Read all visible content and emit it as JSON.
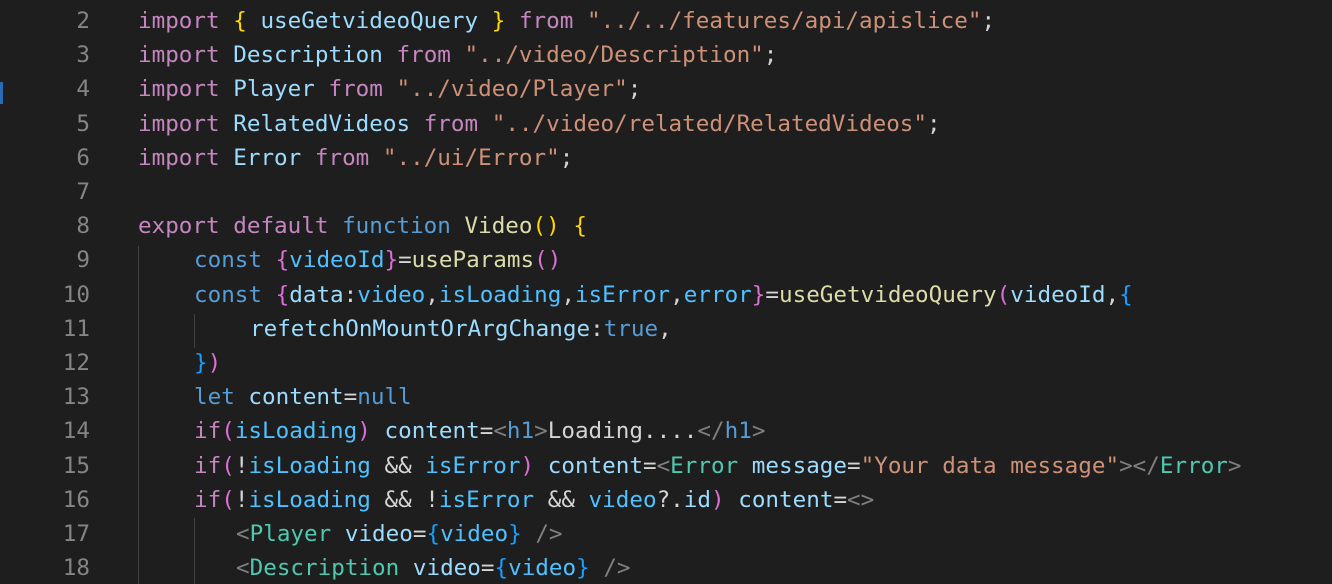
{
  "editor": {
    "lines": [
      {
        "number": "2",
        "indent": 0,
        "tokens": [
          {
            "t": "import",
            "c": "kw"
          },
          {
            "t": " ",
            "c": "p"
          },
          {
            "t": "{",
            "c": "b1"
          },
          {
            "t": " ",
            "c": "p"
          },
          {
            "t": "useGetvideoQuery",
            "c": "var"
          },
          {
            "t": " ",
            "c": "p"
          },
          {
            "t": "}",
            "c": "b1"
          },
          {
            "t": " ",
            "c": "p"
          },
          {
            "t": "from",
            "c": "kw"
          },
          {
            "t": " ",
            "c": "p"
          },
          {
            "t": "\"../../features/api/apislice\"",
            "c": "str"
          },
          {
            "t": ";",
            "c": "p"
          }
        ]
      },
      {
        "number": "3",
        "indent": 0,
        "tokens": [
          {
            "t": "import",
            "c": "kw"
          },
          {
            "t": " ",
            "c": "p"
          },
          {
            "t": "Description",
            "c": "var"
          },
          {
            "t": " ",
            "c": "p"
          },
          {
            "t": "from",
            "c": "kw"
          },
          {
            "t": " ",
            "c": "p"
          },
          {
            "t": "\"../video/Description\"",
            "c": "str"
          },
          {
            "t": ";",
            "c": "p"
          }
        ]
      },
      {
        "number": "4",
        "indent": 0,
        "tokens": [
          {
            "t": "import",
            "c": "kw"
          },
          {
            "t": " ",
            "c": "p"
          },
          {
            "t": "Player",
            "c": "var"
          },
          {
            "t": " ",
            "c": "p"
          },
          {
            "t": "from",
            "c": "kw"
          },
          {
            "t": " ",
            "c": "p"
          },
          {
            "t": "\"../video/Player\"",
            "c": "str"
          },
          {
            "t": ";",
            "c": "p"
          }
        ]
      },
      {
        "number": "5",
        "indent": 0,
        "tokens": [
          {
            "t": "import",
            "c": "kw"
          },
          {
            "t": " ",
            "c": "p"
          },
          {
            "t": "RelatedVideos",
            "c": "var"
          },
          {
            "t": " ",
            "c": "p"
          },
          {
            "t": "from",
            "c": "kw"
          },
          {
            "t": " ",
            "c": "p"
          },
          {
            "t": "\"../video/related/RelatedVideos\"",
            "c": "str"
          },
          {
            "t": ";",
            "c": "p"
          }
        ]
      },
      {
        "number": "6",
        "indent": 0,
        "tokens": [
          {
            "t": "import",
            "c": "kw"
          },
          {
            "t": " ",
            "c": "p"
          },
          {
            "t": "Error",
            "c": "var"
          },
          {
            "t": " ",
            "c": "p"
          },
          {
            "t": "from",
            "c": "kw"
          },
          {
            "t": " ",
            "c": "p"
          },
          {
            "t": "\"../ui/Error\"",
            "c": "str"
          },
          {
            "t": ";",
            "c": "p"
          }
        ]
      },
      {
        "number": "7",
        "indent": 0,
        "tokens": []
      },
      {
        "number": "8",
        "indent": 0,
        "tokens": [
          {
            "t": "export",
            "c": "kw"
          },
          {
            "t": " ",
            "c": "p"
          },
          {
            "t": "default",
            "c": "kw"
          },
          {
            "t": " ",
            "c": "p"
          },
          {
            "t": "function",
            "c": "st"
          },
          {
            "t": " ",
            "c": "p"
          },
          {
            "t": "Video",
            "c": "fn"
          },
          {
            "t": "()",
            "c": "b1"
          },
          {
            "t": " ",
            "c": "p"
          },
          {
            "t": "{",
            "c": "b1"
          }
        ]
      },
      {
        "number": "9",
        "indent": 1,
        "tokens": [
          {
            "t": "const",
            "c": "st"
          },
          {
            "t": " ",
            "c": "p"
          },
          {
            "t": "{",
            "c": "b2"
          },
          {
            "t": "videoId",
            "c": "const"
          },
          {
            "t": "}",
            "c": "b2"
          },
          {
            "t": "=",
            "c": "p"
          },
          {
            "t": "useParams",
            "c": "fn"
          },
          {
            "t": "()",
            "c": "b2"
          }
        ]
      },
      {
        "number": "10",
        "indent": 1,
        "tokens": [
          {
            "t": "const",
            "c": "st"
          },
          {
            "t": " ",
            "c": "p"
          },
          {
            "t": "{",
            "c": "b2"
          },
          {
            "t": "data",
            "c": "var"
          },
          {
            "t": ":",
            "c": "p"
          },
          {
            "t": "video",
            "c": "const"
          },
          {
            "t": ",",
            "c": "p"
          },
          {
            "t": "isLoading",
            "c": "const"
          },
          {
            "t": ",",
            "c": "p"
          },
          {
            "t": "isError",
            "c": "const"
          },
          {
            "t": ",",
            "c": "p"
          },
          {
            "t": "error",
            "c": "const"
          },
          {
            "t": "}",
            "c": "b2"
          },
          {
            "t": "=",
            "c": "p"
          },
          {
            "t": "useGetvideoQuery",
            "c": "fn"
          },
          {
            "t": "(",
            "c": "b2"
          },
          {
            "t": "videoId",
            "c": "var"
          },
          {
            "t": ",",
            "c": "p"
          },
          {
            "t": "{",
            "c": "b3"
          }
        ]
      },
      {
        "number": "11",
        "indent": 2,
        "tokens": [
          {
            "t": "refetchOnMountOrArgChange",
            "c": "var"
          },
          {
            "t": ":",
            "c": "p"
          },
          {
            "t": "true",
            "c": "st"
          },
          {
            "t": ",",
            "c": "p"
          }
        ]
      },
      {
        "number": "12",
        "indent": 1,
        "tokens": [
          {
            "t": "}",
            "c": "b3"
          },
          {
            "t": ")",
            "c": "b2"
          }
        ]
      },
      {
        "number": "13",
        "indent": 1,
        "tokens": [
          {
            "t": "let",
            "c": "st"
          },
          {
            "t": " ",
            "c": "p"
          },
          {
            "t": "content",
            "c": "var"
          },
          {
            "t": "=",
            "c": "p"
          },
          {
            "t": "null",
            "c": "st"
          }
        ]
      },
      {
        "number": "14",
        "indent": 1,
        "tokens": [
          {
            "t": "if",
            "c": "kw"
          },
          {
            "t": "(",
            "c": "b2"
          },
          {
            "t": "isLoading",
            "c": "const"
          },
          {
            "t": ")",
            "c": "b2"
          },
          {
            "t": " ",
            "c": "p"
          },
          {
            "t": "content",
            "c": "var"
          },
          {
            "t": "=",
            "c": "p"
          },
          {
            "t": "<",
            "c": "tag"
          },
          {
            "t": "h1",
            "c": "el"
          },
          {
            "t": ">",
            "c": "tag"
          },
          {
            "t": "Loading....",
            "c": "text"
          },
          {
            "t": "</",
            "c": "tag"
          },
          {
            "t": "h1",
            "c": "el"
          },
          {
            "t": ">",
            "c": "tag"
          }
        ]
      },
      {
        "number": "15",
        "indent": 1,
        "tokens": [
          {
            "t": "if",
            "c": "kw"
          },
          {
            "t": "(",
            "c": "b2"
          },
          {
            "t": "!",
            "c": "p"
          },
          {
            "t": "isLoading",
            "c": "const"
          },
          {
            "t": " && ",
            "c": "p"
          },
          {
            "t": "isError",
            "c": "const"
          },
          {
            "t": ")",
            "c": "b2"
          },
          {
            "t": " ",
            "c": "p"
          },
          {
            "t": "content",
            "c": "var"
          },
          {
            "t": "=",
            "c": "p"
          },
          {
            "t": "<",
            "c": "tag"
          },
          {
            "t": "Error",
            "c": "comp"
          },
          {
            "t": " ",
            "c": "p"
          },
          {
            "t": "message",
            "c": "var"
          },
          {
            "t": "=",
            "c": "p"
          },
          {
            "t": "\"Your data message\"",
            "c": "str"
          },
          {
            "t": "></",
            "c": "tag"
          },
          {
            "t": "Error",
            "c": "comp"
          },
          {
            "t": ">",
            "c": "tag"
          }
        ]
      },
      {
        "number": "16",
        "indent": 1,
        "tokens": [
          {
            "t": "if",
            "c": "kw"
          },
          {
            "t": "(",
            "c": "b2"
          },
          {
            "t": "!",
            "c": "p"
          },
          {
            "t": "isLoading",
            "c": "const"
          },
          {
            "t": " && ",
            "c": "p"
          },
          {
            "t": "!",
            "c": "p"
          },
          {
            "t": "isError",
            "c": "const"
          },
          {
            "t": " && ",
            "c": "p"
          },
          {
            "t": "video",
            "c": "const"
          },
          {
            "t": "?.",
            "c": "p"
          },
          {
            "t": "id",
            "c": "var"
          },
          {
            "t": ")",
            "c": "b2"
          },
          {
            "t": " ",
            "c": "p"
          },
          {
            "t": "content",
            "c": "var"
          },
          {
            "t": "=",
            "c": "p"
          },
          {
            "t": "<>",
            "c": "tag"
          }
        ]
      },
      {
        "number": "17",
        "indent": 1.75,
        "tokens": [
          {
            "t": "<",
            "c": "tag"
          },
          {
            "t": "Player",
            "c": "comp"
          },
          {
            "t": " ",
            "c": "p"
          },
          {
            "t": "video",
            "c": "var"
          },
          {
            "t": "=",
            "c": "p"
          },
          {
            "t": "{",
            "c": "b3"
          },
          {
            "t": "video",
            "c": "const"
          },
          {
            "t": "}",
            "c": "b3"
          },
          {
            "t": " ",
            "c": "p"
          },
          {
            "t": "/>",
            "c": "tag"
          }
        ]
      },
      {
        "number": "18",
        "indent": 1.75,
        "tokens": [
          {
            "t": "<",
            "c": "tag"
          },
          {
            "t": "Description",
            "c": "comp"
          },
          {
            "t": " ",
            "c": "p"
          },
          {
            "t": "video",
            "c": "var"
          },
          {
            "t": "=",
            "c": "p"
          },
          {
            "t": "{",
            "c": "b3"
          },
          {
            "t": "video",
            "c": "const"
          },
          {
            "t": "}",
            "c": "b3"
          },
          {
            "t": " ",
            "c": "p"
          },
          {
            "t": "/>",
            "c": "tag"
          }
        ]
      }
    ]
  }
}
